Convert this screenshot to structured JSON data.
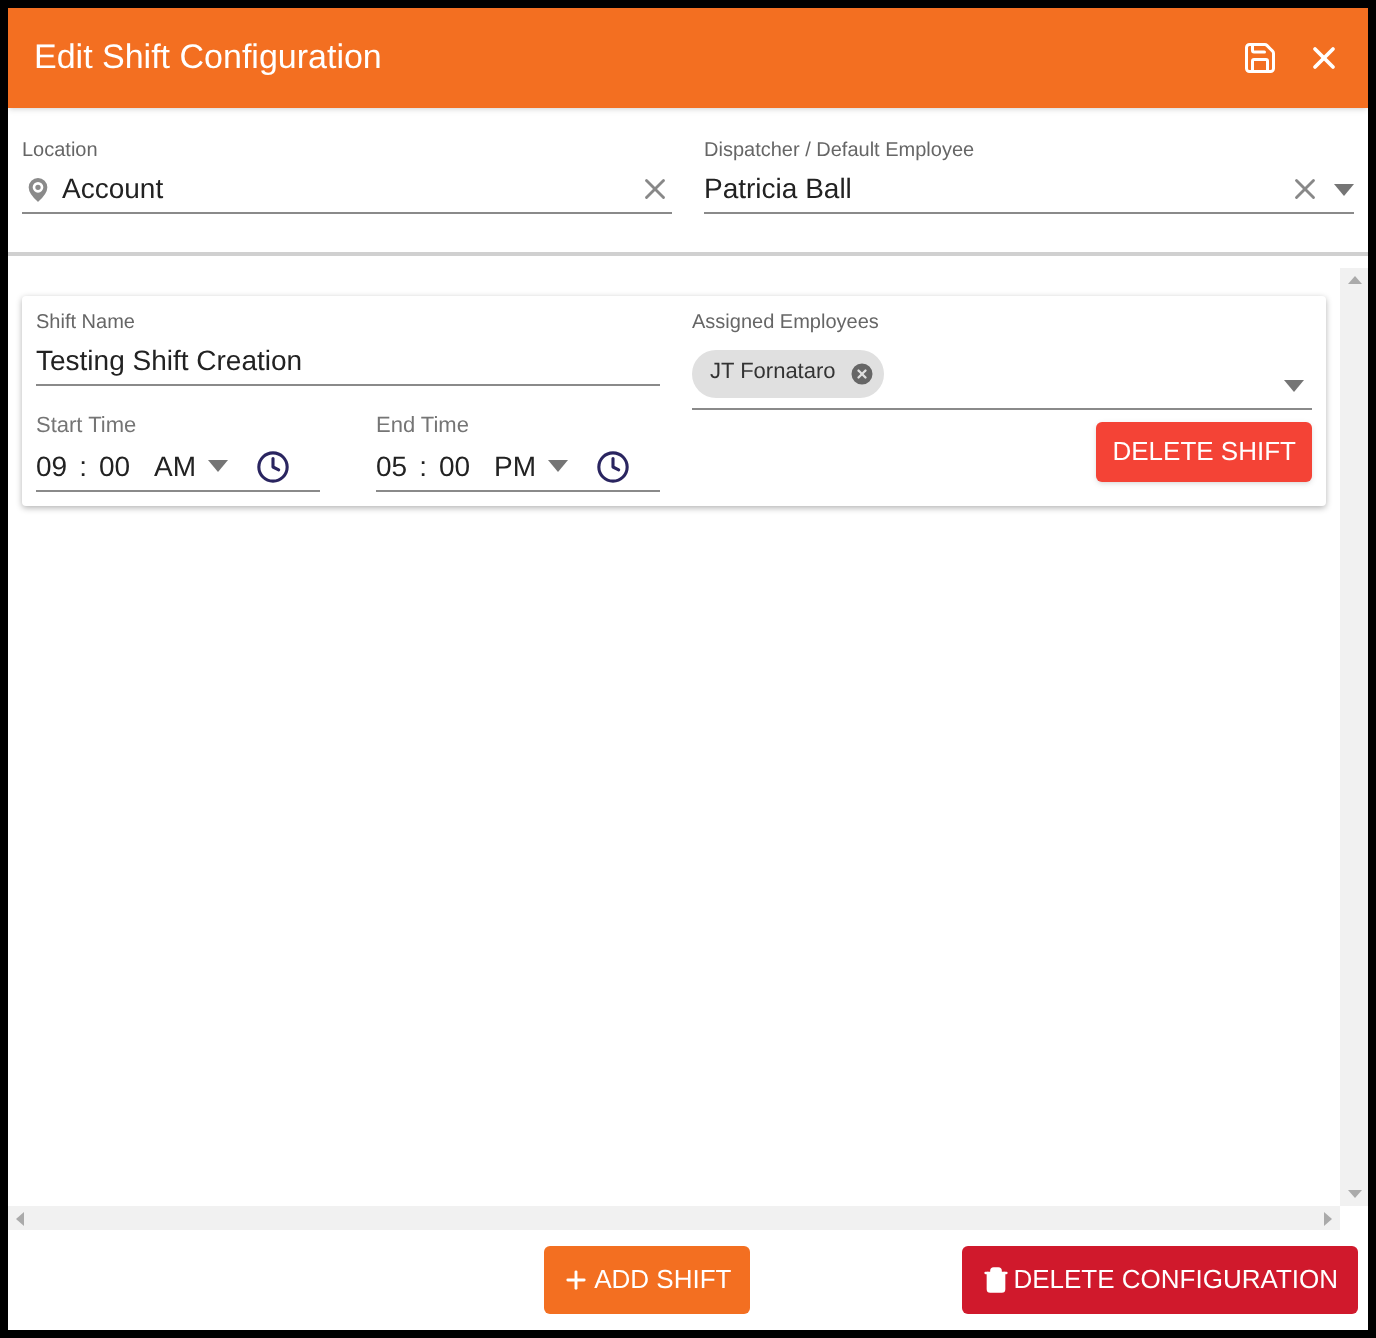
{
  "window": {
    "title": "Edit Shift Configuration"
  },
  "location": {
    "label": "Location",
    "value": "Account"
  },
  "dispatcher": {
    "label": "Dispatcher / Default Employee",
    "value": "Patricia Ball"
  },
  "shifts": [
    {
      "name_label": "Shift Name",
      "name": "Testing Shift Creation",
      "employees_label": "Assigned Employees",
      "employees": [
        "JT Fornataro"
      ],
      "times": [
        {
          "label": "Start Time",
          "hour": "09",
          "separator": ":",
          "minute": "00",
          "period": "AM"
        },
        {
          "label": "End Time",
          "hour": "05",
          "separator": ":",
          "minute": "00",
          "period": "PM"
        }
      ],
      "delete_label": "DELETE SHIFT"
    }
  ],
  "footer": {
    "add_label": "ADD SHIFT",
    "delete_label": "DELETE CONFIGURATION"
  }
}
